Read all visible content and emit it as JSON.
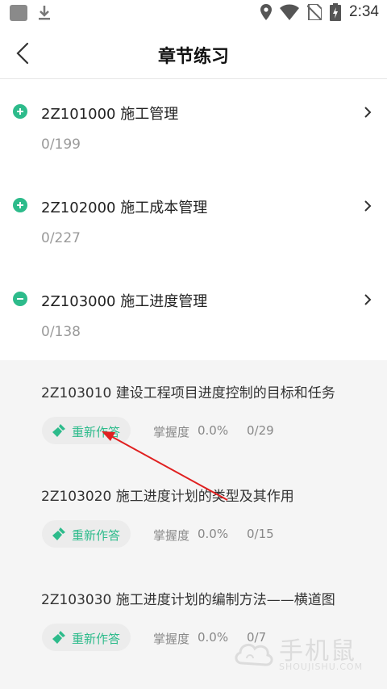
{
  "status_bar": {
    "time": "2:34"
  },
  "header": {
    "title": "章节练习"
  },
  "chapters": [
    {
      "title": "2Z101000 施工管理",
      "count": "0/199",
      "state": "expand"
    },
    {
      "title": "2Z102000 施工成本管理",
      "count": "0/227",
      "state": "expand"
    },
    {
      "title": "2Z103000 施工进度管理",
      "count": "0/138",
      "state": "collapse"
    }
  ],
  "sections": [
    {
      "title": "2Z103010 建设工程项目进度控制的目标和任务",
      "redo_label": "重新作答",
      "mastery_label": "掌握度",
      "mastery_value": "0.0%",
      "progress": "0/29"
    },
    {
      "title": "2Z103020 施工进度计划的类型及其作用",
      "redo_label": "重新作答",
      "mastery_label": "掌握度",
      "mastery_value": "0.0%",
      "progress": "0/15"
    },
    {
      "title": "2Z103030 施工进度计划的编制方法——横道图",
      "redo_label": "重新作答",
      "mastery_label": "掌握度",
      "mastery_value": "0.0%",
      "progress": "0/7"
    }
  ],
  "watermark": {
    "text": "手机鼠",
    "sub": "SHOUJISHU.COM"
  },
  "colors": {
    "accent": "#2dbb8b",
    "annotation": "#e02020"
  }
}
